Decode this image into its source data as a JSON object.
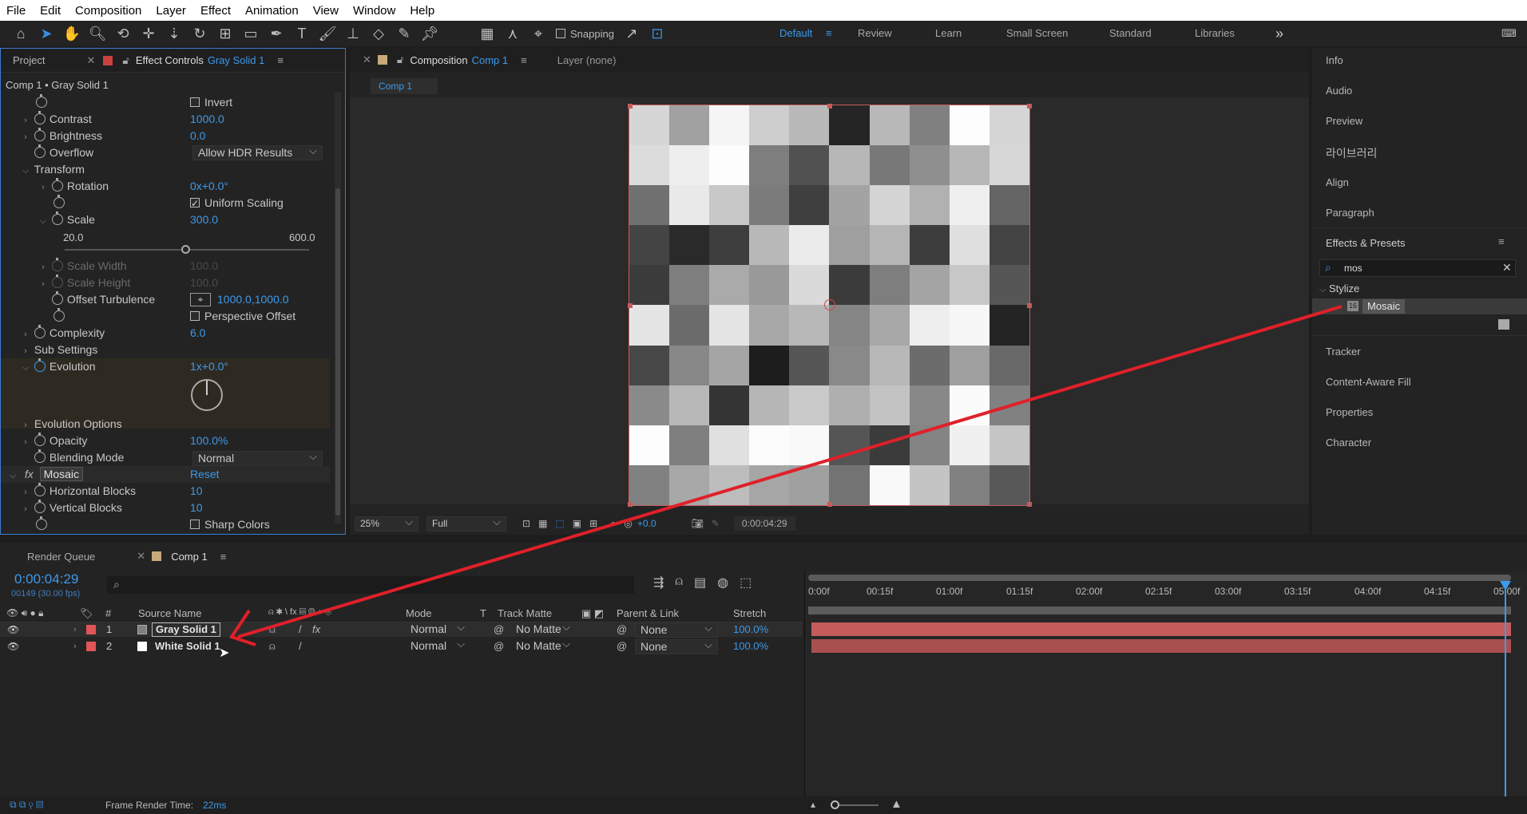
{
  "menubar": [
    "File",
    "Edit",
    "Composition",
    "Layer",
    "Effect",
    "Animation",
    "View",
    "Window",
    "Help"
  ],
  "toolbar": {
    "snapping_label": "Snapping",
    "workspaces": [
      "Default",
      "Review",
      "Learn",
      "Small Screen",
      "Standard",
      "Libraries"
    ],
    "overflow": "»"
  },
  "left_panel": {
    "tab_project": "Project",
    "tab_effect_controls": "Effect Controls",
    "tab_effect_controls_layer": "Gray Solid 1",
    "breadcrumb": "Comp 1 • Gray Solid 1",
    "invert_label": "Invert",
    "contrast_label": "Contrast",
    "contrast_value": "1000.0",
    "brightness_label": "Brightness",
    "brightness_value": "0.0",
    "overflow_label": "Overflow",
    "overflow_value": "Allow HDR Results",
    "transform_label": "Transform",
    "rotation_label": "Rotation",
    "rotation_value": "0x+0.0°",
    "uniform_scaling_label": "Uniform Scaling",
    "scale_label": "Scale",
    "scale_value": "300.0",
    "scale_min": "20.0",
    "scale_max": "600.0",
    "scale_slider_fraction": 0.3,
    "scale_width_label": "Scale Width",
    "scale_width_value": "100.0",
    "scale_height_label": "Scale Height",
    "scale_height_value": "100.0",
    "offset_turbulence_label": "Offset Turbulence",
    "offset_turbulence_value": "1000.0,1000.0",
    "perspective_offset_label": "Perspective Offset",
    "complexity_label": "Complexity",
    "complexity_value": "6.0",
    "sub_settings_label": "Sub Settings",
    "evolution_label": "Evolution",
    "evolution_value": "1x+0.0°",
    "evolution_options_label": "Evolution Options",
    "opacity_label": "Opacity",
    "opacity_value": "100.0%",
    "blending_mode_label": "Blending Mode",
    "blending_mode_value": "Normal",
    "mosaic_fx": "fx",
    "mosaic_label": "Mosaic",
    "mosaic_reset": "Reset",
    "horizontal_blocks_label": "Horizontal Blocks",
    "horizontal_blocks_value": "10",
    "vertical_blocks_label": "Vertical Blocks",
    "vertical_blocks_value": "10",
    "sharp_colors_label": "Sharp Colors"
  },
  "comp_panel": {
    "tab_composition": "Composition",
    "tab_comp_name": "Comp 1",
    "tab_layer": "Layer (none)",
    "comp_chip": "Comp 1",
    "zoom": "25%",
    "resolution": "Full",
    "exposure": "+0.0",
    "timecode": "0:00:04:29",
    "mosaic_grid": [
      [
        214,
        161,
        245,
        206,
        185,
        37,
        185,
        128,
        253,
        213
      ],
      [
        220,
        238,
        253,
        126,
        81,
        183,
        120,
        143,
        183,
        215
      ],
      [
        112,
        233,
        200,
        123,
        63,
        163,
        212,
        177,
        239,
        100
      ],
      [
        68,
        42,
        62,
        185,
        235,
        159,
        181,
        61,
        223,
        67
      ],
      [
        59,
        126,
        170,
        153,
        218,
        59,
        126,
        164,
        199,
        86
      ],
      [
        229,
        108,
        229,
        168,
        184,
        133,
        168,
        238,
        247,
        36
      ],
      [
        71,
        136,
        165,
        29,
        86,
        137,
        184,
        108,
        159,
        104
      ],
      [
        138,
        184,
        52,
        182,
        202,
        175,
        195,
        136,
        251,
        129
      ],
      [
        253,
        127,
        224,
        252,
        249,
        85,
        59,
        132,
        240,
        197
      ],
      [
        129,
        168,
        189,
        166,
        160,
        115,
        249,
        196,
        129,
        88
      ]
    ]
  },
  "right_panel": {
    "items_top": [
      "Info",
      "Audio",
      "Preview",
      "라이브러리",
      "Align",
      "Paragraph"
    ],
    "effects_presets": "Effects & Presets",
    "search_value": "mos",
    "stylize": "Stylize",
    "mosaic_result": "Mosaic",
    "items_bottom": [
      "Tracker",
      "Content-Aware Fill",
      "Properties",
      "Character"
    ]
  },
  "timeline": {
    "tab_render_queue": "Render Queue",
    "tab_comp": "Comp 1",
    "current_time": "0:00:04:29",
    "frame_info": "00149 (30.00 fps)",
    "columns": {
      "hash": "#",
      "source_name": "Source Name",
      "mode": "Mode",
      "t": "T",
      "track_matte": "Track Matte",
      "parent_link": "Parent & Link",
      "stretch": "Stretch"
    },
    "ruler": [
      "0:00f",
      "00:15f",
      "01:00f",
      "01:15f",
      "02:00f",
      "02:15f",
      "03:00f",
      "03:15f",
      "04:00f",
      "04:15f",
      "05:00f"
    ],
    "layers": [
      {
        "num": "1",
        "name": "Gray Solid 1",
        "swatch": "#808080",
        "mode": "Normal",
        "matte": "No Matte",
        "parent": "None",
        "stretch": "100.0%"
      },
      {
        "num": "2",
        "name": "White Solid 1",
        "swatch": "#ffffff",
        "mode": "Normal",
        "matte": "No Matte",
        "parent": "None",
        "stretch": "100.0%"
      }
    ],
    "render_time_label": "Frame Render Time:",
    "render_time_value": "22ms"
  },
  "colors": {
    "accent": "#3d9aea",
    "label_red": "#e05555",
    "bar_red": "#c45c5c",
    "annotation": "#e0202a"
  }
}
